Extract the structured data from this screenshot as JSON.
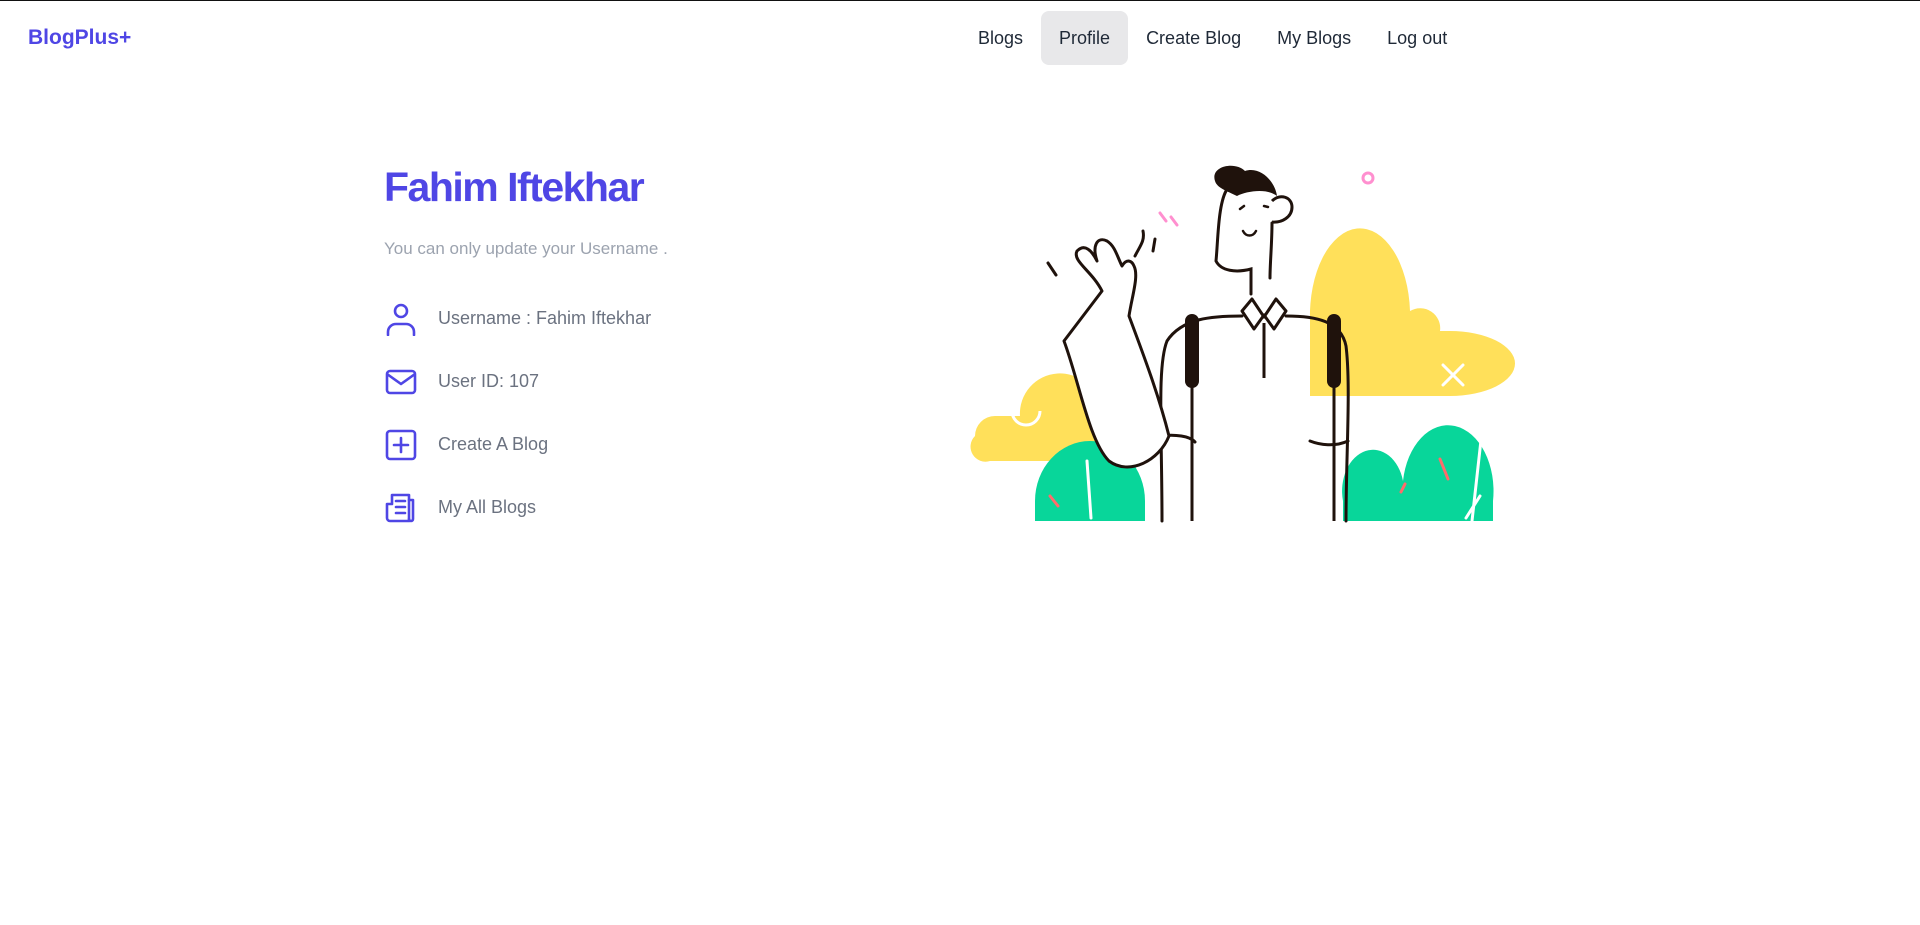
{
  "brand": "BlogPlus+",
  "nav": {
    "items": [
      "Blogs",
      "Profile",
      "Create Blog",
      "My Blogs",
      "Log out"
    ],
    "active": "Profile"
  },
  "profile": {
    "name": "Fahim Iftekhar",
    "note": "You can only update your Username .",
    "items": [
      {
        "icon": "user-icon",
        "label": "Username : Fahim Iftekhar"
      },
      {
        "icon": "mail-icon",
        "label": "User ID: 107"
      },
      {
        "icon": "plus-square-icon",
        "label": "Create A Blog"
      },
      {
        "icon": "newspaper-icon",
        "label": "My All Blogs"
      }
    ]
  },
  "colors": {
    "accent": "#4f46e5",
    "nav_active_bg": "#e8e8ea",
    "muted_text": "#6b7280",
    "illustration_yellow": "#ffe05a",
    "illustration_green": "#08d69a",
    "illustration_pink": "#ff8fcf"
  }
}
